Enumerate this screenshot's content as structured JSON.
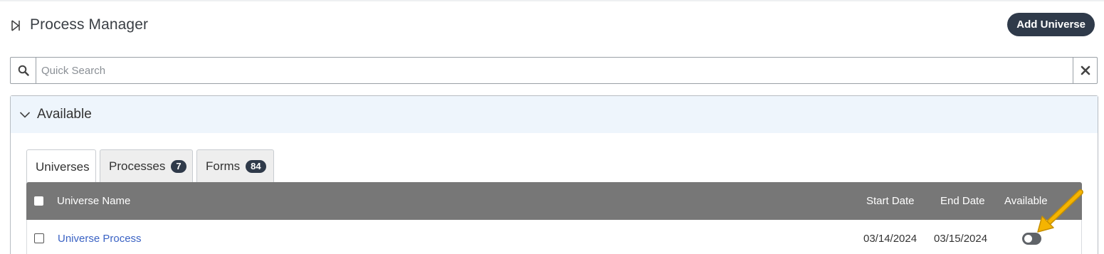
{
  "header": {
    "title": "Process Manager",
    "add_button": "Add Universe"
  },
  "search": {
    "placeholder": "Quick Search",
    "value": ""
  },
  "panel": {
    "label": "Available"
  },
  "tabs": [
    {
      "label": "Universes",
      "badge": ""
    },
    {
      "label": "Processes",
      "badge": "7"
    },
    {
      "label": "Forms",
      "badge": "84"
    }
  ],
  "grid": {
    "columns": {
      "name": "Universe Name",
      "start": "Start Date",
      "end": "End Date",
      "available": "Available"
    },
    "rows": [
      {
        "name": "Universe Process",
        "start": "03/14/2024",
        "end": "03/15/2024",
        "available": false
      }
    ]
  },
  "colors": {
    "button_bg": "#2f3a4a",
    "grid_header": "#777777",
    "panel_header": "#eef5fc",
    "link": "#3b63c4",
    "annotation_arrow": "#f5b400"
  },
  "icons": [
    "play-outline-icon",
    "search-icon",
    "close-icon",
    "chevron-down-icon",
    "arrow-annotation-icon"
  ]
}
